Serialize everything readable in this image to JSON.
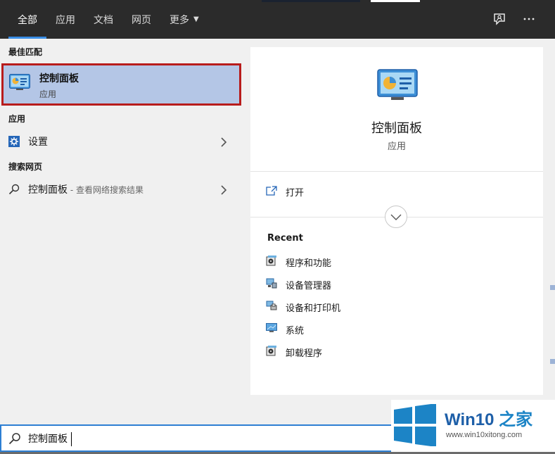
{
  "tabs": [
    {
      "label": "全部",
      "active": true
    },
    {
      "label": "应用",
      "active": false
    },
    {
      "label": "文档",
      "active": false
    },
    {
      "label": "网页",
      "active": false
    },
    {
      "label": "更多",
      "active": false
    }
  ],
  "top_icons": {
    "feedback": "feedback-icon",
    "more": "ellipsis-icon"
  },
  "left": {
    "best_match_heading": "最佳匹配",
    "best_match": {
      "title": "控制面板",
      "subtitle": "应用",
      "icon": "control-panel-icon"
    },
    "apps_heading": "应用",
    "apps": [
      {
        "label": "设置",
        "icon": "gear-icon"
      }
    ],
    "web_heading": "搜索网页",
    "web": [
      {
        "label": "控制面板",
        "suffix": " - 查看网络搜索结果",
        "icon": "search-icon"
      }
    ]
  },
  "detail": {
    "title": "控制面板",
    "type": "应用",
    "open_label": "打开",
    "recent_heading": "Recent",
    "recent": [
      {
        "label": "程序和功能",
        "icon": "programs-icon"
      },
      {
        "label": "设备管理器",
        "icon": "device-manager-icon"
      },
      {
        "label": "设备和打印机",
        "icon": "devices-printers-icon"
      },
      {
        "label": "系统",
        "icon": "system-icon"
      },
      {
        "label": "卸载程序",
        "icon": "uninstall-icon"
      }
    ]
  },
  "search": {
    "value": "控制面板"
  },
  "watermark": {
    "brand": "Win10",
    "brand_zh": "之家",
    "url": "www.win10xitong.com"
  },
  "colors": {
    "accent": "#3a8ee6",
    "selection": "#b4c6e6",
    "highlight_border": "#b81c1c",
    "topbar": "#2b2b2b"
  }
}
